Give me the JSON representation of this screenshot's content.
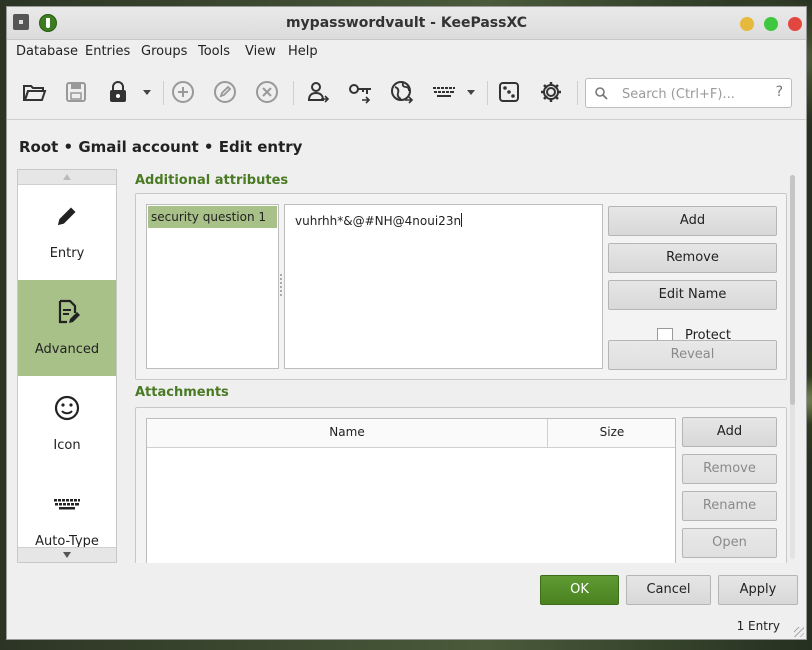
{
  "window": {
    "title": "mypasswordvault - KeePassXC"
  },
  "menu": [
    "Database",
    "Entries",
    "Groups",
    "Tools",
    "View",
    "Help"
  ],
  "search": {
    "placeholder": "Search (Ctrl+F)...",
    "help": "?"
  },
  "breadcrumb": "Root • Gmail account • Edit entry",
  "categories": [
    {
      "label": "Entry",
      "icon": "pencil-icon",
      "active": false
    },
    {
      "label": "Advanced",
      "icon": "document-edit-icon",
      "active": true
    },
    {
      "label": "Icon",
      "icon": "smiley-icon",
      "active": false
    },
    {
      "label": "Auto-Type",
      "icon": "keyboard-icon",
      "active": false
    }
  ],
  "additional_attributes": {
    "title": "Additional attributes",
    "items": [
      "security question 1"
    ],
    "value": "vuhrhh*&@#NH@4noui23n",
    "buttons": {
      "add": "Add",
      "remove": "Remove",
      "edit_name": "Edit Name",
      "reveal": "Reveal"
    },
    "protect_label": "Protect"
  },
  "attachments": {
    "title": "Attachments",
    "columns": [
      "Name",
      "Size"
    ],
    "buttons": {
      "add": "Add",
      "remove": "Remove",
      "rename": "Rename",
      "open": "Open"
    }
  },
  "dialog_buttons": {
    "ok": "OK",
    "cancel": "Cancel",
    "apply": "Apply"
  },
  "status": "1 Entry",
  "colors": {
    "accent": "#4a7a24",
    "selection": "#a8c189",
    "primary_button": "#5a9230"
  }
}
